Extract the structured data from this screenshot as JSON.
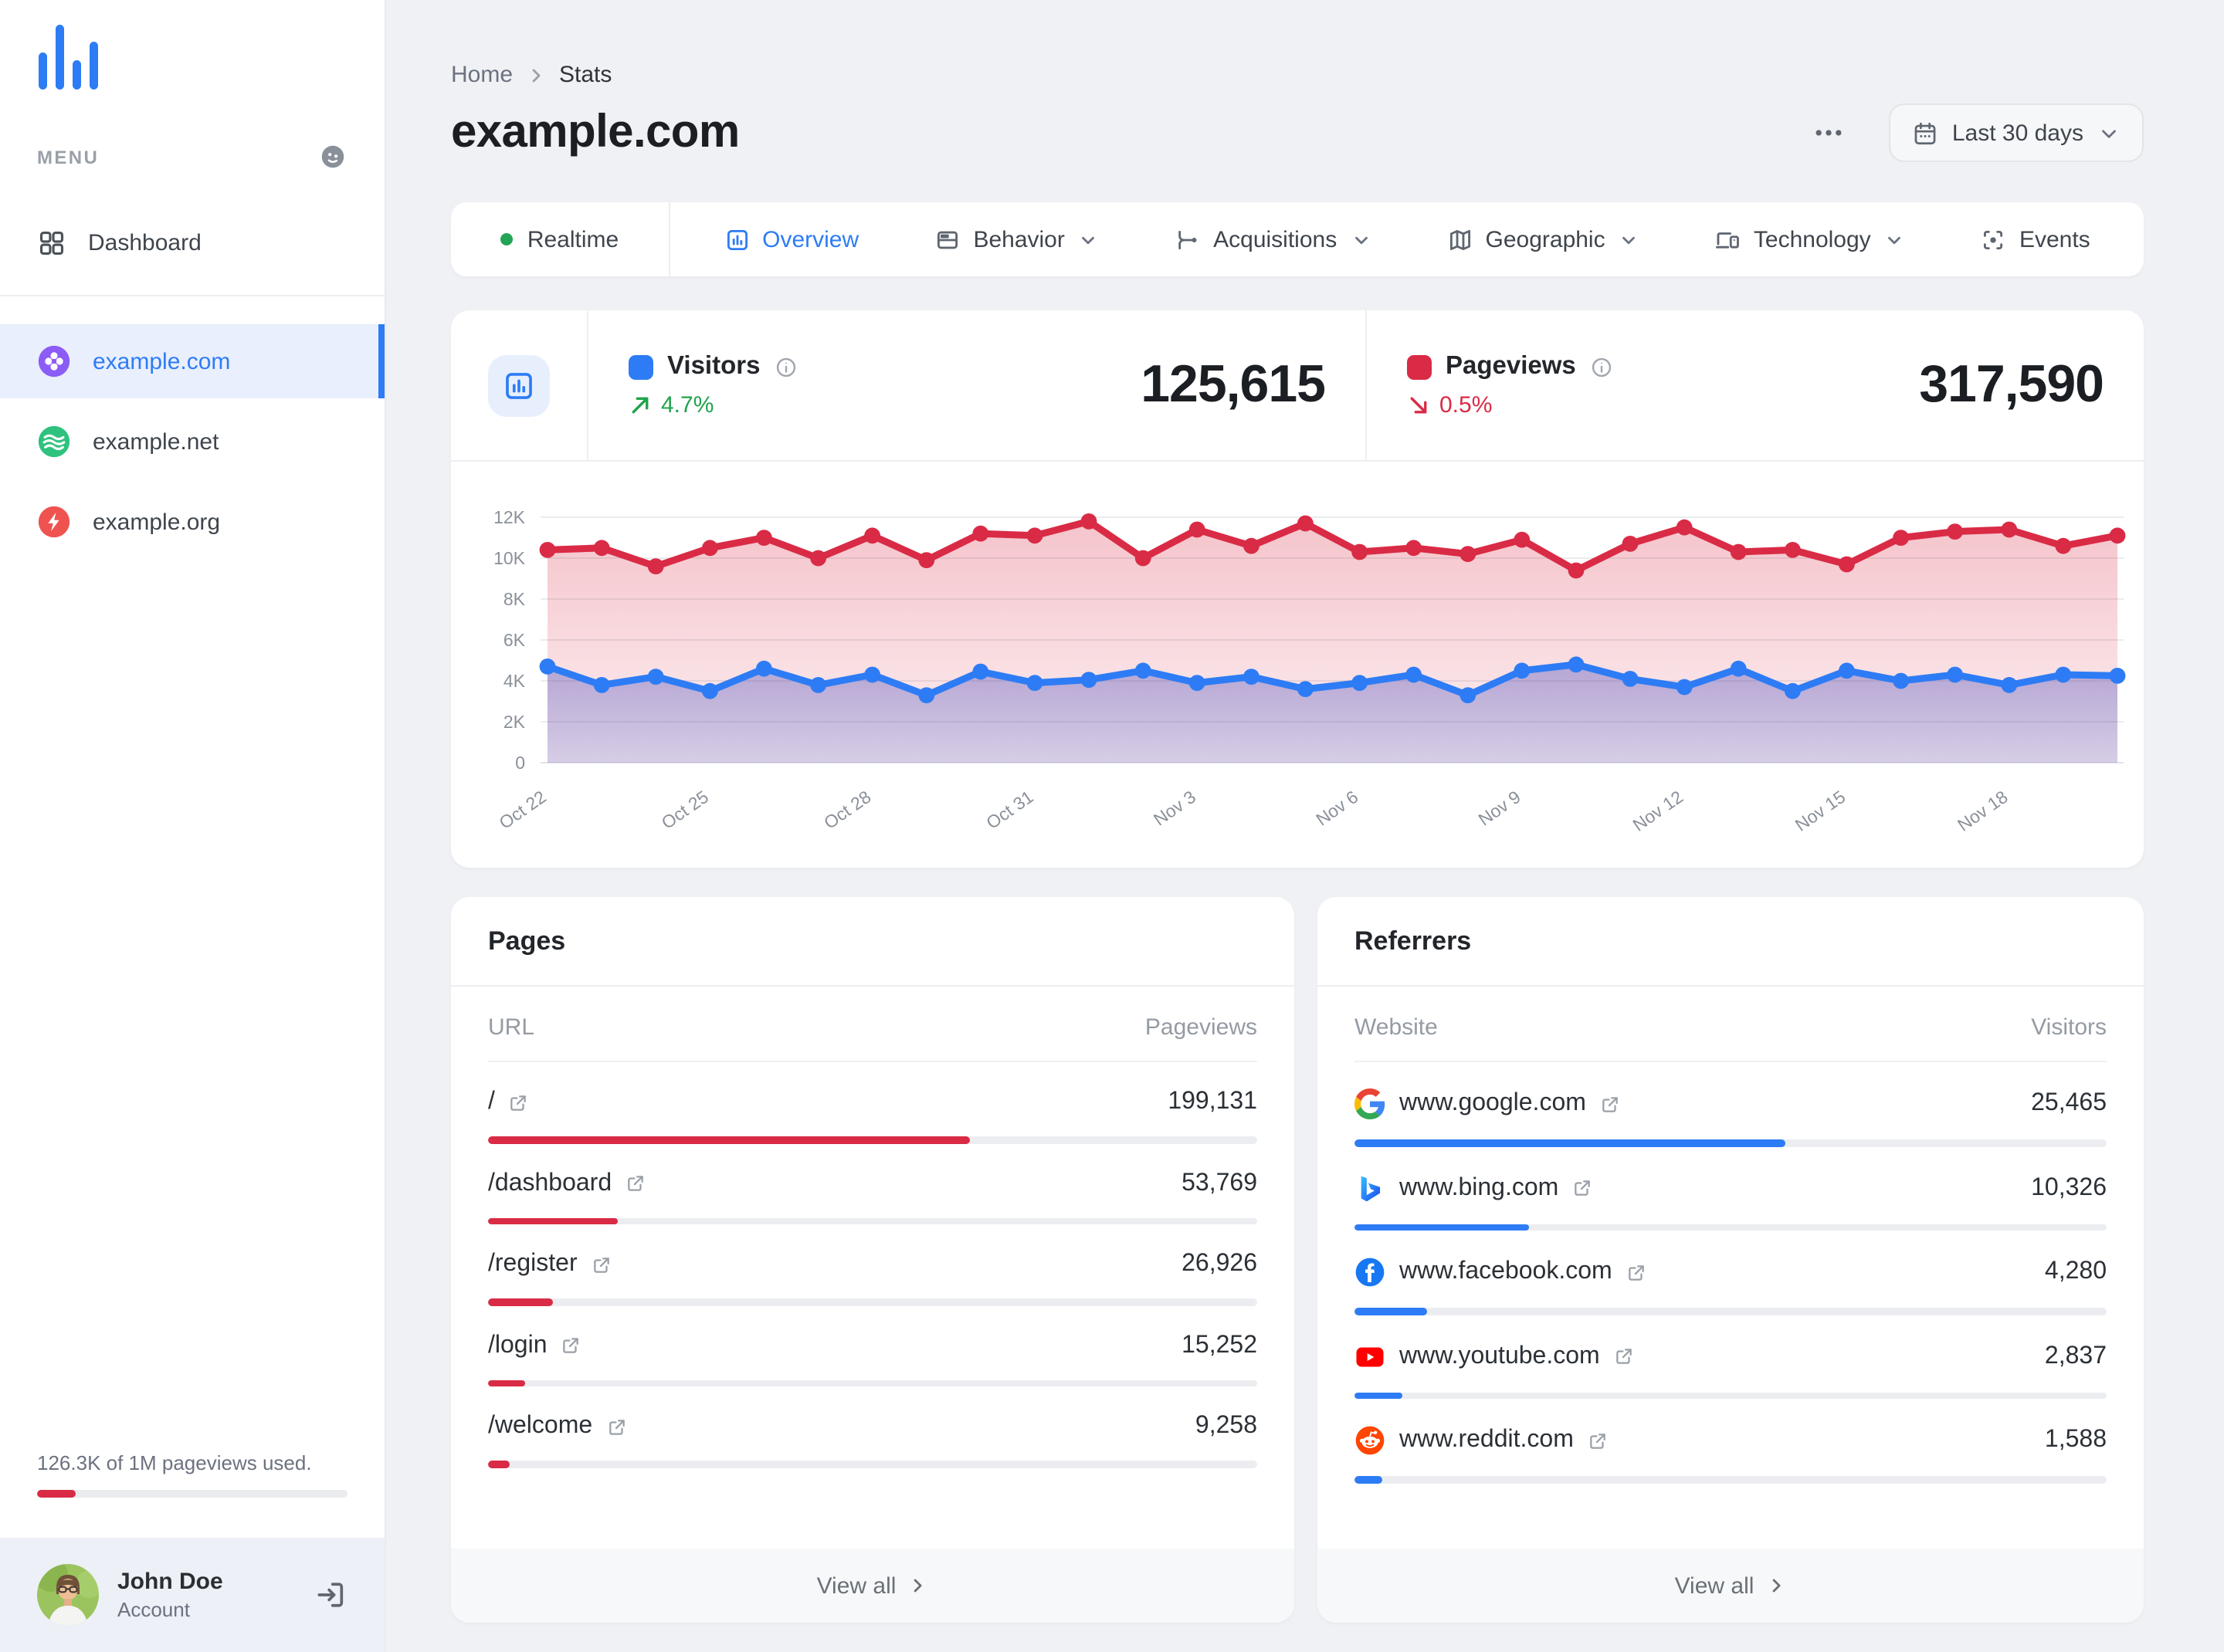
{
  "colors": {
    "accent_blue": "#2e7cf5",
    "negative_red": "#d92b45",
    "positive_green": "#21a34c",
    "bar_track": "#ebedf0",
    "active_item_bg": "#e9effc"
  },
  "sidebar": {
    "menu_label": "MENU",
    "dashboard_label": "Dashboard",
    "sites": [
      {
        "name": "example.com",
        "icon": "clover-icon",
        "color": "#8b5cf6",
        "active": true
      },
      {
        "name": "example.net",
        "icon": "waves-icon",
        "color": "#2ec27e",
        "active": false
      },
      {
        "name": "example.org",
        "icon": "bolt-icon",
        "color": "#ef5350",
        "active": false
      }
    ],
    "usage": {
      "text": "126.3K of 1M pageviews used.",
      "percent": 12.6
    },
    "user": {
      "name": "John Doe",
      "role": "Account"
    }
  },
  "header": {
    "breadcrumb": [
      "Home",
      "Stats"
    ],
    "title": "example.com",
    "date_range_label": "Last 30 days"
  },
  "tabs": [
    {
      "label": "Realtime",
      "icon": "realtime-dot-icon",
      "active": false,
      "chevron": false
    },
    {
      "label": "Overview",
      "icon": "overview-icon",
      "active": true,
      "chevron": false
    },
    {
      "label": "Behavior",
      "icon": "behavior-icon",
      "active": false,
      "chevron": true
    },
    {
      "label": "Acquisitions",
      "icon": "acquisitions-icon",
      "active": false,
      "chevron": true
    },
    {
      "label": "Geographic",
      "icon": "geographic-icon",
      "active": false,
      "chevron": true
    },
    {
      "label": "Technology",
      "icon": "technology-icon",
      "active": false,
      "chevron": true
    },
    {
      "label": "Events",
      "icon": "events-icon",
      "active": false,
      "chevron": false
    }
  ],
  "stats": [
    {
      "label": "Visitors",
      "value": "125,615",
      "change": "4.7%",
      "trend": "up",
      "marker_color": "#2e7cf5"
    },
    {
      "label": "Pageviews",
      "value": "317,590",
      "change": "0.5%",
      "trend": "down",
      "marker_color": "#d92b45"
    }
  ],
  "chart_data": {
    "type": "area",
    "title": "",
    "x": [
      "Oct 22",
      "Oct 23",
      "Oct 24",
      "Oct 25",
      "Oct 26",
      "Oct 27",
      "Oct 28",
      "Oct 29",
      "Oct 30",
      "Oct 31",
      "Nov 1",
      "Nov 2",
      "Nov 3",
      "Nov 4",
      "Nov 5",
      "Nov 6",
      "Nov 7",
      "Nov 8",
      "Nov 9",
      "Nov 10",
      "Nov 11",
      "Nov 12",
      "Nov 13",
      "Nov 14",
      "Nov 15",
      "Nov 16",
      "Nov 17",
      "Nov 18",
      "Nov 19",
      "Nov 20"
    ],
    "x_tick_labels": [
      "Oct 22",
      "Oct 25",
      "Oct 28",
      "Oct 31",
      "Nov 3",
      "Nov 6",
      "Nov 9",
      "Nov 12",
      "Nov 15",
      "Nov 18"
    ],
    "x_label_every": 3,
    "series": [
      {
        "name": "Pageviews",
        "color": "#d92b45",
        "values": [
          10400,
          10500,
          9600,
          10500,
          11000,
          10000,
          11100,
          9900,
          11200,
          11100,
          11800,
          10000,
          11400,
          10600,
          11700,
          10300,
          10500,
          10200,
          10900,
          9400,
          10700,
          11500,
          10300,
          10400,
          9700,
          11000,
          11300,
          11400,
          10600,
          11100
        ]
      },
      {
        "name": "Visitors",
        "color": "#2e7cf5",
        "values": [
          4700,
          3800,
          4200,
          3500,
          4600,
          3800,
          4300,
          3300,
          4450,
          3900,
          4050,
          4500,
          3900,
          4200,
          3600,
          3900,
          4300,
          3300,
          4500,
          4800,
          4100,
          3700,
          4600,
          3500,
          4500,
          4000,
          4300,
          3800,
          4300,
          4250
        ]
      }
    ],
    "ylim": [
      0,
      12000
    ],
    "y_tick_labels": [
      "0",
      "2K",
      "4K",
      "6K",
      "8K",
      "10K",
      "12K"
    ],
    "grid": true,
    "legend_position": "none"
  },
  "pages_panel": {
    "title": "Pages",
    "columns": [
      "URL",
      "Pageviews"
    ],
    "rows": [
      {
        "url": "/",
        "pageviews": "199,131",
        "bar_fraction": 0.627
      },
      {
        "url": "/dashboard",
        "pageviews": "53,769",
        "bar_fraction": 0.169
      },
      {
        "url": "/register",
        "pageviews": "26,926",
        "bar_fraction": 0.085
      },
      {
        "url": "/login",
        "pageviews": "15,252",
        "bar_fraction": 0.048
      },
      {
        "url": "/welcome",
        "pageviews": "9,258",
        "bar_fraction": 0.029
      }
    ],
    "view_all_label": "View all",
    "bar_color": "#d92b45"
  },
  "referrers_panel": {
    "title": "Referrers",
    "columns": [
      "Website",
      "Visitors"
    ],
    "rows": [
      {
        "site": "www.google.com",
        "visitors": "25,465",
        "icon": "google-favicon",
        "bar_fraction": 0.572
      },
      {
        "site": "www.bing.com",
        "visitors": "10,326",
        "icon": "bing-favicon",
        "bar_fraction": 0.232
      },
      {
        "site": "www.facebook.com",
        "visitors": "4,280",
        "icon": "facebook-favicon",
        "bar_fraction": 0.096
      },
      {
        "site": "www.youtube.com",
        "visitors": "2,837",
        "icon": "youtube-favicon",
        "bar_fraction": 0.064
      },
      {
        "site": "www.reddit.com",
        "visitors": "1,588",
        "icon": "reddit-favicon",
        "bar_fraction": 0.036
      }
    ],
    "view_all_label": "View all",
    "bar_color": "#2e7cf5"
  }
}
